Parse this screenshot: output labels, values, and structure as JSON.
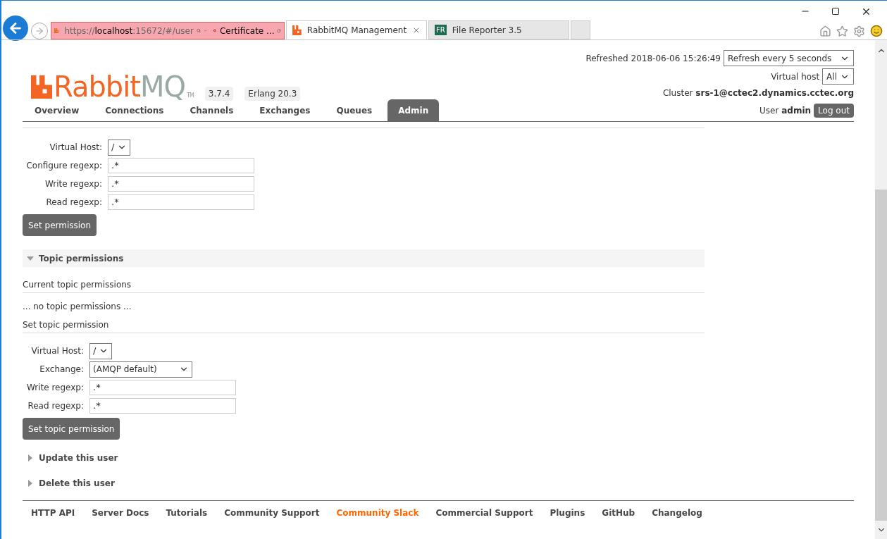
{
  "browser": {
    "address": {
      "scheme": "https://",
      "host": "localhost",
      "rest": ":15672/#/user"
    },
    "certificate": "Certificate ...",
    "tabs": [
      {
        "label": "RabbitMQ Management",
        "selected": true,
        "kind": "rabbit"
      },
      {
        "label": "File Reporter 3.5",
        "selected": false,
        "kind": "badge",
        "badge": "FR"
      }
    ]
  },
  "header": {
    "logo": {
      "first": "Rabbit",
      "second": "MQ",
      "tm": "TM"
    },
    "versions": [
      "3.7.4",
      "Erlang 20.3"
    ],
    "refreshed": "Refreshed 2018-06-06 15:26:49",
    "refresh_select": "Refresh every 5 seconds",
    "vhost_label": "Virtual host",
    "vhost_select": "All",
    "cluster_label": "Cluster",
    "cluster": "srs-1@cctec2.dynamics.cctec.org",
    "user_label": "User",
    "user": "admin",
    "logout": "Log out"
  },
  "nav": [
    {
      "label": "Overview",
      "selected": false
    },
    {
      "label": "Connections",
      "selected": false
    },
    {
      "label": "Channels",
      "selected": false
    },
    {
      "label": "Exchanges",
      "selected": false
    },
    {
      "label": "Queues",
      "selected": false
    },
    {
      "label": "Admin",
      "selected": true
    }
  ],
  "permission_form": {
    "fields": [
      {
        "label": "Virtual Host:",
        "kind": "select",
        "value": "/"
      },
      {
        "label": "Configure regexp:",
        "kind": "input",
        "value": ".*"
      },
      {
        "label": "Write regexp:",
        "kind": "input",
        "value": ".*"
      },
      {
        "label": "Read regexp:",
        "kind": "input",
        "value": ".*"
      }
    ],
    "button": "Set permission"
  },
  "topic_section": {
    "title": "Topic permissions",
    "expanded": true,
    "current_heading": "Current topic permissions",
    "empty_text": "... no topic permissions ...",
    "set_heading": "Set topic permission",
    "fields": [
      {
        "label": "Virtual Host:",
        "kind": "select",
        "value": "/"
      },
      {
        "label": "Exchange:",
        "kind": "wide_select",
        "value": "(AMQP default)"
      },
      {
        "label": "Write regexp:",
        "kind": "input",
        "value": ".*"
      },
      {
        "label": "Read regexp:",
        "kind": "input",
        "value": ".*"
      }
    ],
    "button": "Set topic permission"
  },
  "sections": [
    {
      "title": "Update this user",
      "expanded": false
    },
    {
      "title": "Delete this user",
      "expanded": false
    }
  ],
  "footer": [
    {
      "label": "HTTP API",
      "highlighted": false
    },
    {
      "label": "Server Docs",
      "highlighted": false
    },
    {
      "label": "Tutorials",
      "highlighted": false
    },
    {
      "label": "Community Support",
      "highlighted": false
    },
    {
      "label": "Community Slack",
      "highlighted": true
    },
    {
      "label": "Commercial Support",
      "highlighted": false
    },
    {
      "label": "Plugins",
      "highlighted": false
    },
    {
      "label": "GitHub",
      "highlighted": false
    },
    {
      "label": "Changelog",
      "highlighted": false
    }
  ]
}
